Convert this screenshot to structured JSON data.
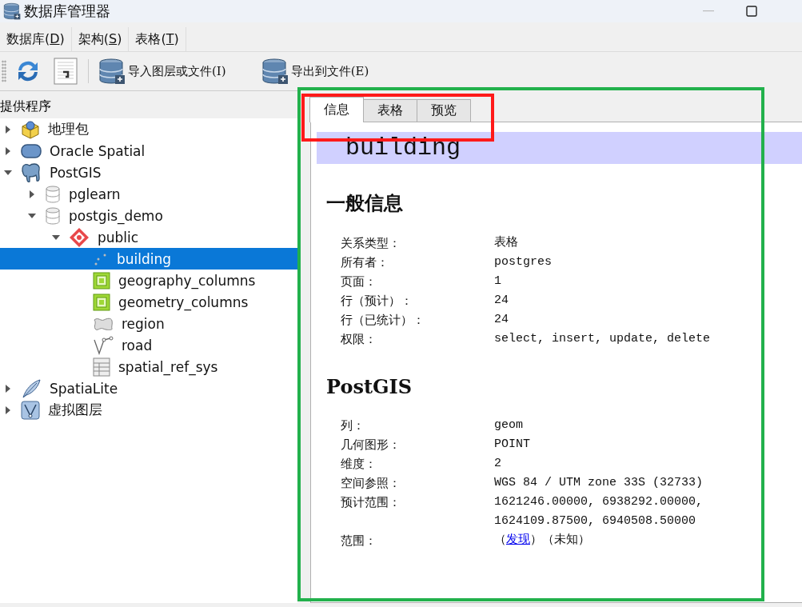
{
  "window": {
    "title": "数据库管理器"
  },
  "menu": [
    {
      "before": "数据库(",
      "key": "D",
      "after": ")"
    },
    {
      "before": "架构(",
      "key": "S",
      "after": ")"
    },
    {
      "before": "表格(",
      "key": "T",
      "after": ")"
    }
  ],
  "toolbar": [
    {
      "kind": "refresh"
    },
    {
      "kind": "sql"
    },
    {
      "kind": "import",
      "label": "导入图层或文件(I)"
    },
    {
      "kind": "export",
      "label": "导出到文件(E)"
    }
  ],
  "providers": {
    "title": "提供程序",
    "items": [
      {
        "kind": "geopackage",
        "label": "地理包",
        "expanded": false,
        "selected": false
      },
      {
        "kind": "oracle",
        "label": "Oracle Spatial",
        "expanded": false,
        "selected": false
      },
      {
        "kind": "postgis",
        "label": "PostGIS",
        "expanded": true,
        "selected": false,
        "children": [
          {
            "kind": "database",
            "label": "pglearn",
            "expanded": false,
            "selected": false
          },
          {
            "kind": "database",
            "label": "postgis_demo",
            "expanded": true,
            "selected": false,
            "children": [
              {
                "kind": "schema",
                "label": "public",
                "expanded": true,
                "selected": false,
                "children": [
                  {
                    "kind": "point",
                    "label": "building",
                    "selected": true
                  },
                  {
                    "kind": "geotable",
                    "label": "geography_columns",
                    "selected": false
                  },
                  {
                    "kind": "geotable",
                    "label": "geometry_columns",
                    "selected": false
                  },
                  {
                    "kind": "polygon",
                    "label": "region",
                    "selected": false
                  },
                  {
                    "kind": "line",
                    "label": "road",
                    "selected": false
                  },
                  {
                    "kind": "table",
                    "label": "spatial_ref_sys",
                    "selected": false
                  }
                ]
              }
            ]
          }
        ]
      },
      {
        "kind": "spatialite",
        "label": "SpatiaLite",
        "expanded": false,
        "selected": false
      },
      {
        "kind": "virtual",
        "label": "虚拟图层",
        "expanded": false,
        "selected": false
      }
    ]
  },
  "tabs": [
    {
      "label": "信息",
      "selected": true
    },
    {
      "label": "表格",
      "selected": false
    },
    {
      "label": "预览",
      "selected": false
    }
  ],
  "info": {
    "title": "building",
    "sections": [
      {
        "heading": "一般信息",
        "rows": [
          {
            "label": "关系类型：",
            "value": "表格"
          },
          {
            "label": "所有者：",
            "value": "postgres"
          },
          {
            "label": "页面：",
            "value": "1"
          },
          {
            "label": "行（预计）：",
            "value": "24"
          },
          {
            "label": "行（已统计）：",
            "value": "24"
          },
          {
            "label": "权限：",
            "value": "select, insert, update, delete"
          }
        ]
      },
      {
        "heading": "PostGIS",
        "rows": [
          {
            "label": "列：",
            "value": "geom"
          },
          {
            "label": "几何图形：",
            "value": "POINT"
          },
          {
            "label": "维度：",
            "value": "2"
          },
          {
            "label": "空间参照：",
            "value": "WGS 84 / UTM zone 33S (32733)"
          },
          {
            "label": "预计范围：",
            "value": "1621246.00000, 6938292.00000, 1624109.87500, 6940508.50000"
          },
          {
            "label": "范围：",
            "value": "（",
            "link": "发现",
            "after": "）（未知）"
          }
        ]
      }
    ]
  },
  "annotations": [
    {
      "color": "#22b14c"
    },
    {
      "color": "#ff1a1a"
    }
  ]
}
